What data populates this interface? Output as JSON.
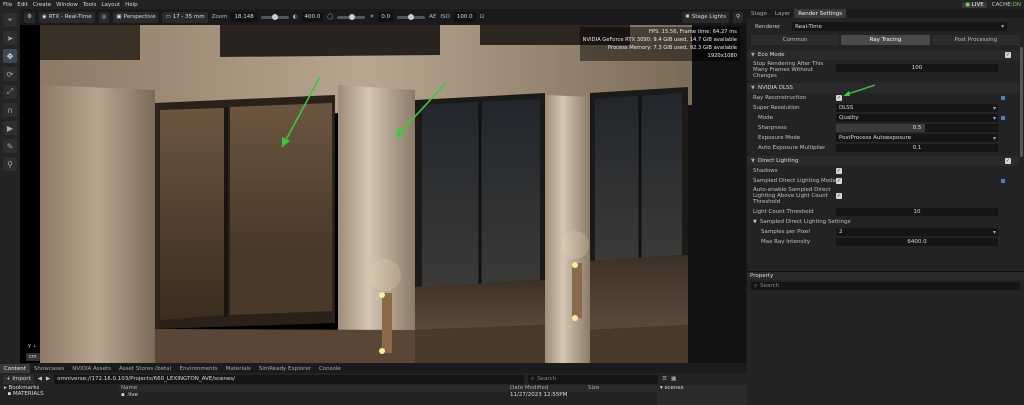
{
  "menu": [
    "File",
    "Edit",
    "Create",
    "Window",
    "Tools",
    "Layout",
    "Help"
  ],
  "status": {
    "live": "LIVE",
    "cache_label": "CACHE:",
    "cache_value": "ON"
  },
  "viewport_toolbar": {
    "renderer": "RTX - Real-Time",
    "camera": "Perspective",
    "lens": "17 - 35 mm",
    "zoom_label": "Zoom",
    "zoom_value": "18.148",
    "focus_value": "400.0",
    "ev_value": "0.0",
    "ae_label": "AE",
    "iso_label": "ISO",
    "iso_value": "100.0",
    "stage_lights": "Stage Lights"
  },
  "hud": {
    "line1": "FPS: 15.56, Frame time: 64.27 ms",
    "line2": "NVIDIA GeForce RTX 3090: 9.4 GiB used, 14.7 GiB available",
    "line3": "Process Memory: 7.3 GiB used, 92.3 GiB available",
    "line4": "1920x1080"
  },
  "axis_label": "y",
  "cm_badge": "cm",
  "right_panel": {
    "tabs": [
      "Stage",
      "Layer",
      "Render Settings"
    ],
    "renderer_label": "Renderer",
    "renderer_value": "Real-Time",
    "subtabs": [
      "Common",
      "Ray Tracing",
      "Post Processing"
    ],
    "eco": {
      "title": "Eco Mode",
      "stop_label": "Stop Rendering After This Many Frames Without Changes",
      "stop_value": "100"
    },
    "dlss": {
      "title": "NVIDIA DLSS",
      "ray_recon": "Ray Reconstruction",
      "super_res": "Super Resolution",
      "super_res_value": "DLSS",
      "mode": "Mode",
      "mode_value": "Quality",
      "sharpness": "Sharpness",
      "sharpness_value": "0.5",
      "exposure_mode": "Exposure Mode",
      "exposure_mode_value": "PostProcess Autoexposure",
      "auto_exp_mult": "Auto Exposure Multiplier",
      "auto_exp_mult_value": "0.1"
    },
    "direct": {
      "title": "Direct Lighting",
      "shadows": "Shadows",
      "sampled_mode": "Sampled Direct Lighting Mode",
      "auto_enable": "Auto-enable Sampled Direct Lighting Above Light Count Threshold",
      "light_count": "Light Count Threshold",
      "light_count_value": "10",
      "sampled_settings": "Sampled Direct Lighting Settings",
      "samples_per_pixel": "Samples per Pixel",
      "samples_per_pixel_value": "2",
      "max_ray_intensity": "Max Ray Intensity",
      "max_ray_intensity_value": "6400.0"
    }
  },
  "property": {
    "title": "Property",
    "search_placeholder": "Search"
  },
  "content": {
    "tabs": [
      "Content",
      "Showcases",
      "NVIDIA Assets",
      "Asset Stores (beta)",
      "Environments",
      "Materials",
      "SimReady Explorer",
      "Console"
    ],
    "import": "Import",
    "path": "omniverse://172.16.0.103/Projects/660_LEXINGTON_AVE/scenes/",
    "search_placeholder": "Search",
    "bookmarks": "Bookmarks",
    "materials": "MATERIALS",
    "col_name": "Name",
    "col_date": "Date Modified",
    "col_size": "Size",
    "row_name": ".live",
    "row_date": "11/27/2023 12:55PM",
    "scenes": "scenes"
  },
  "colors": {
    "accent": "#4e7fbd",
    "arrow": "#3cc83c",
    "live": "#7cc84f"
  }
}
